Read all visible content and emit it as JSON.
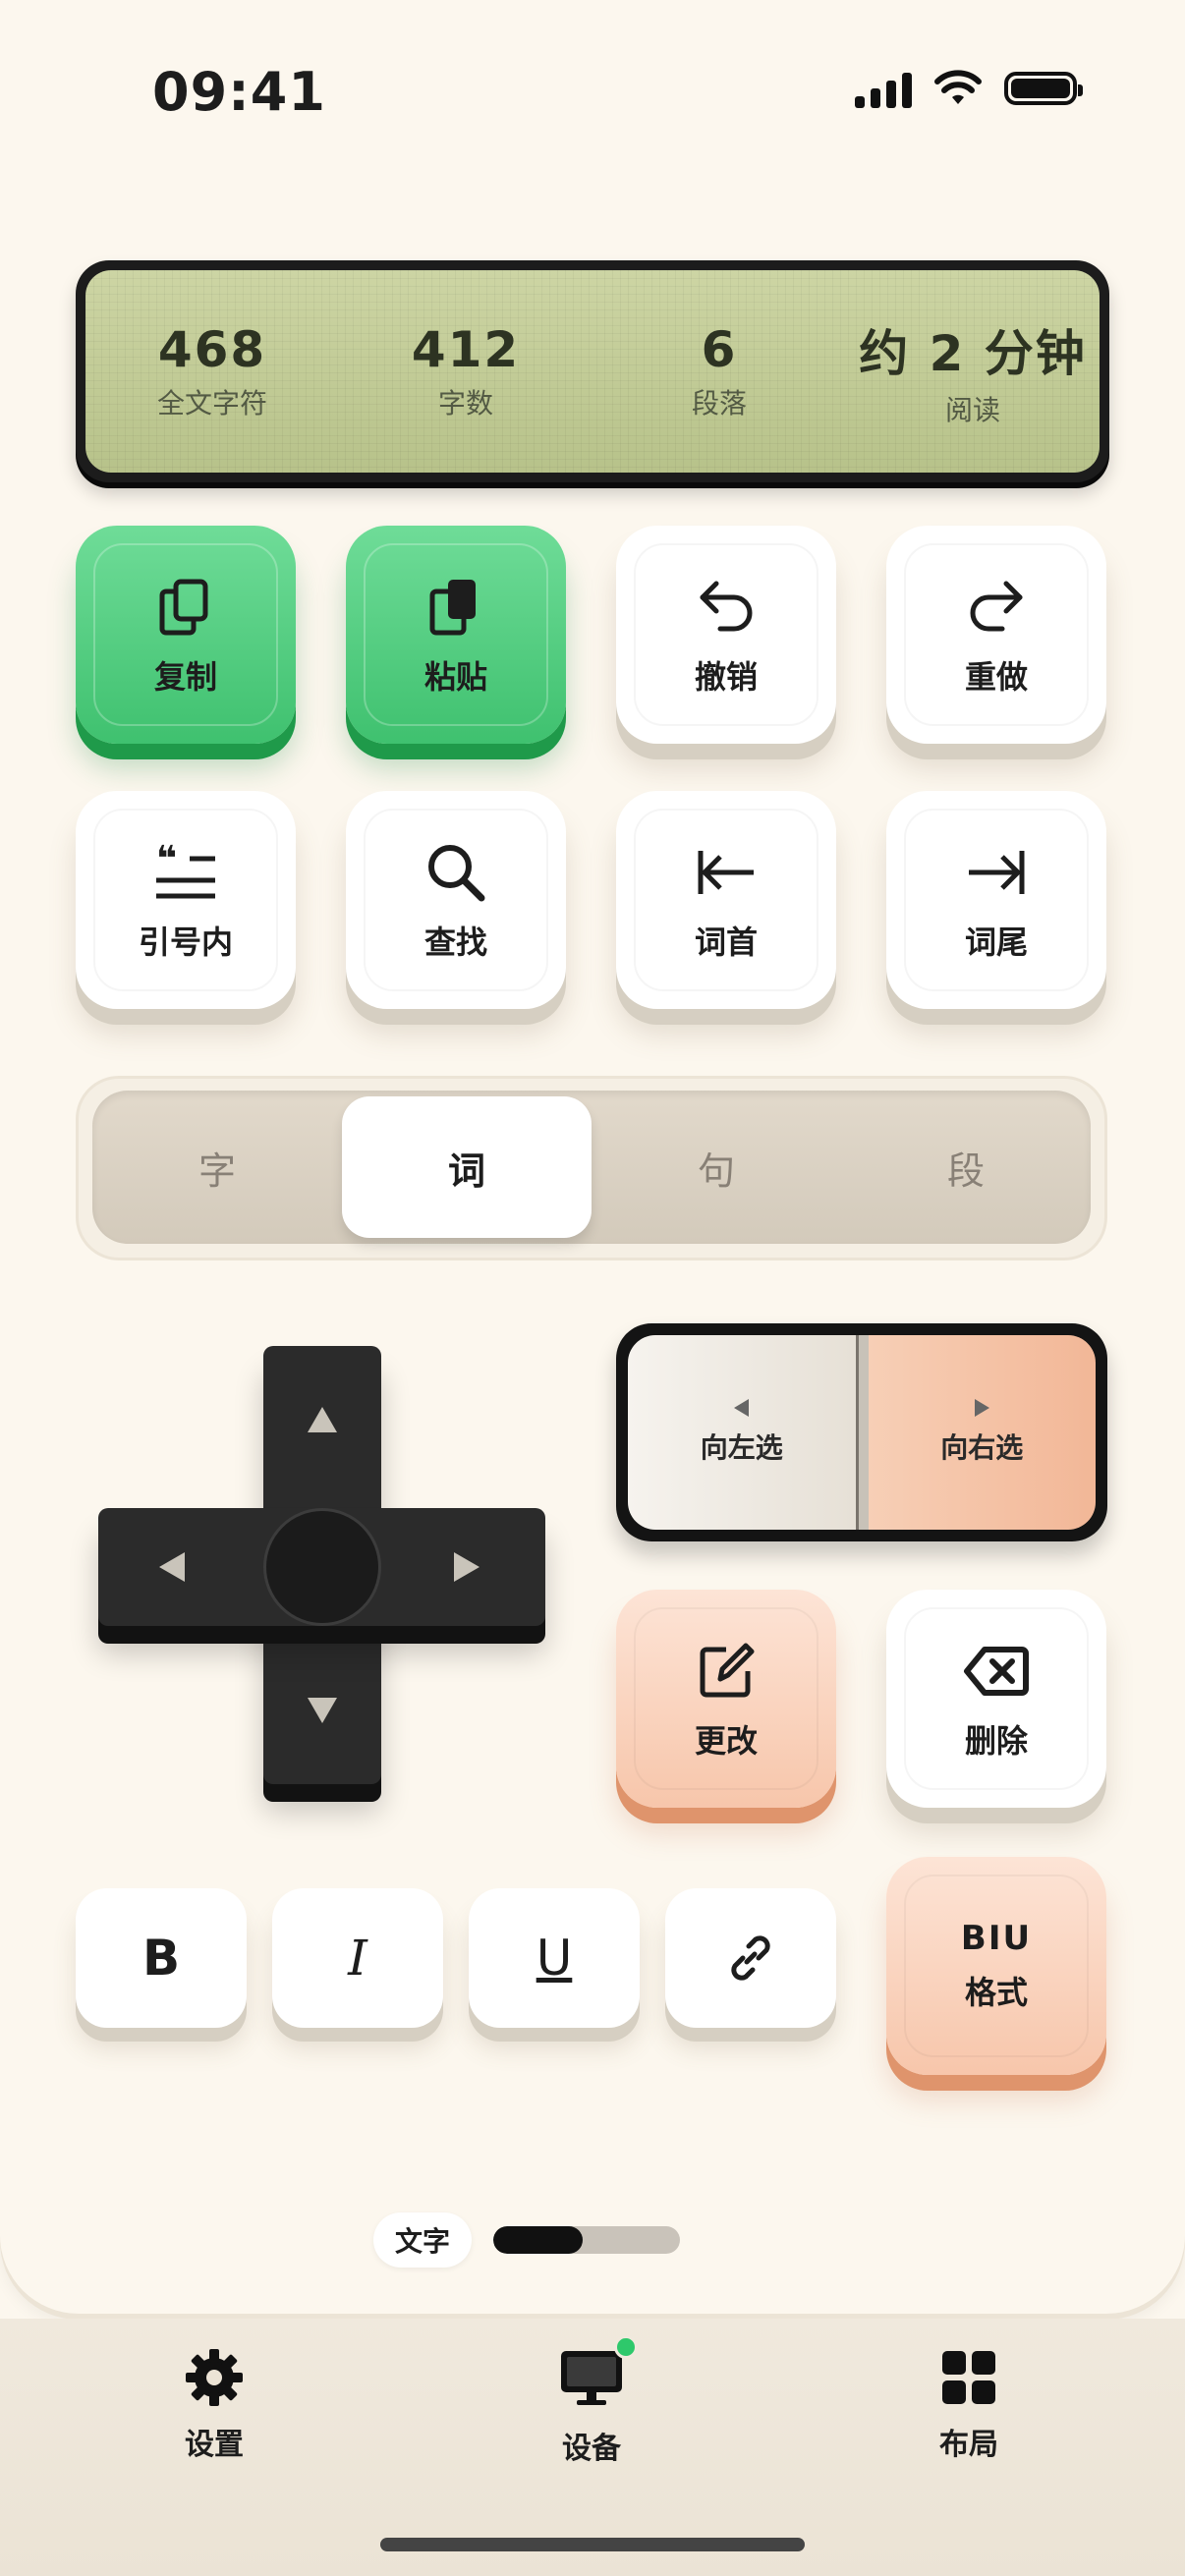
{
  "status_bar": {
    "time": "09:41"
  },
  "stats": [
    {
      "value": "468",
      "label": "全文字符"
    },
    {
      "value": "412",
      "label": "字数"
    },
    {
      "value": "6",
      "label": "段落"
    },
    {
      "value": "约 2 分钟",
      "label": "阅读"
    }
  ],
  "keys_row1": [
    {
      "label": "复制",
      "icon": "copy-icon"
    },
    {
      "label": "粘贴",
      "icon": "paste-icon"
    },
    {
      "label": "撤销",
      "icon": "undo-icon"
    },
    {
      "label": "重做",
      "icon": "redo-icon"
    }
  ],
  "keys_row2": [
    {
      "label": "引号内",
      "icon": "quote-icon"
    },
    {
      "label": "查找",
      "icon": "search-icon"
    },
    {
      "label": "词首",
      "icon": "word-start-icon"
    },
    {
      "label": "词尾",
      "icon": "word-end-icon"
    }
  ],
  "granularity": {
    "options": [
      "字",
      "词",
      "句",
      "段"
    ],
    "selected": "词"
  },
  "selection": {
    "left_label": "向左选",
    "right_label": "向右选"
  },
  "edit_keys": {
    "change_label": "更改",
    "delete_label": "删除"
  },
  "format_keys": {
    "bold": "B",
    "italic": "I",
    "underline": "U",
    "format_label": "格式",
    "format_preview": "BIU"
  },
  "page_indicator": {
    "label": "文字",
    "progress": 0.48
  },
  "tabs": [
    {
      "label": "设置",
      "icon": "gear-icon"
    },
    {
      "label": "设备",
      "icon": "monitor-icon"
    },
    {
      "label": "布局",
      "icon": "grid-icon"
    }
  ],
  "colors": {
    "accent_green": "#3fc16f",
    "accent_peach": "#f7c6ab",
    "status_dot": "#2ec86b"
  }
}
